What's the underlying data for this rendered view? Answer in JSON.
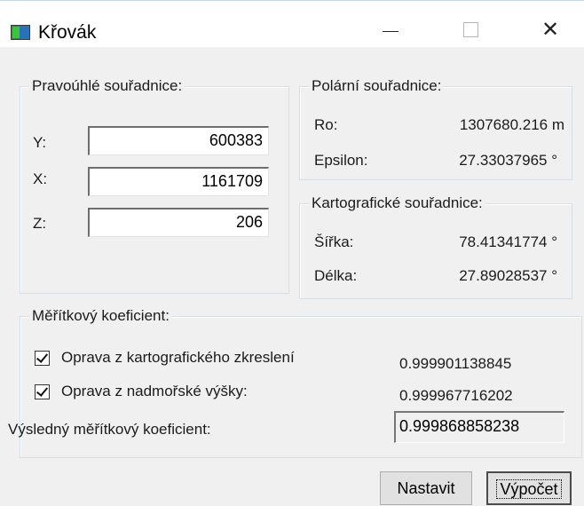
{
  "window": {
    "title": "Křovák",
    "minimize_icon": "minimize-icon",
    "maximize_icon": "maximize-icon",
    "close_glyph": "✕"
  },
  "rect": {
    "legend": "Pravoúhlé souřadnice:",
    "y_label": "Y:",
    "y_value": "600383",
    "x_label": "X:",
    "x_value": "1161709",
    "z_label": "Z:",
    "z_value": "206"
  },
  "polar": {
    "legend": "Polární souřadnice:",
    "ro_label": "Ro:",
    "ro_value": "1307680.216 m",
    "eps_label": "Epsilon:",
    "eps_value": "27.33037965 °"
  },
  "carto": {
    "legend": "Kartografické souřadnice:",
    "lat_label": "Šířka:",
    "lat_value": "78.41341774 °",
    "lon_label": "Délka:",
    "lon_value": "27.89028537 °"
  },
  "scale": {
    "legend": "Měřítkový koeficient:",
    "carto_label": "Oprava z kartografického zkreslení",
    "carto_checked": true,
    "carto_value": "0.999901138845",
    "height_label": "Oprava z nadmořské výšky:",
    "height_checked": true,
    "height_value": "0.999967716202",
    "result_label": "Výsledný měřítkový koeficient:",
    "result_value": "0.999868858238"
  },
  "buttons": {
    "set_label": "Nastavit",
    "compute_label": "Výpočet"
  }
}
